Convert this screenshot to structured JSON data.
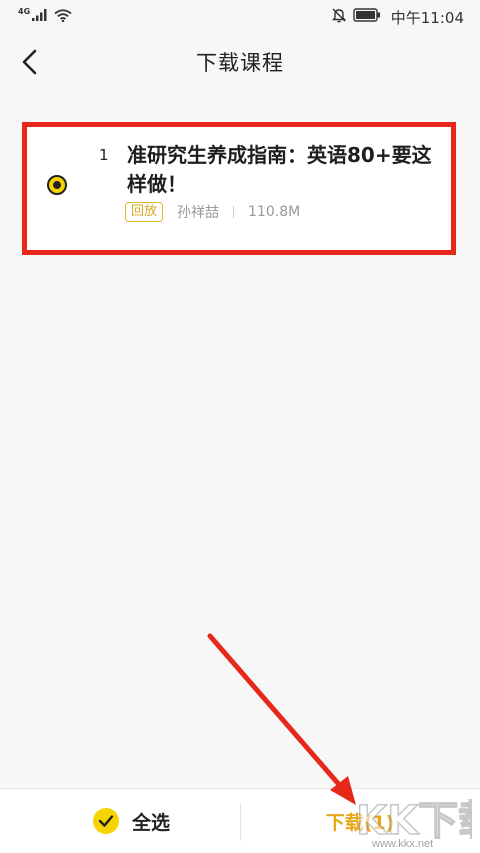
{
  "status_bar": {
    "network": "4G",
    "time": "中午11:04"
  },
  "header": {
    "title": "下载课程"
  },
  "course_list": [
    {
      "index": "1",
      "title": "准研究生养成指南：英语80+要这样做！",
      "badge": "回放",
      "teacher": "孙祥喆",
      "size": "110.8M",
      "selected": true
    }
  ],
  "bottom_bar": {
    "select_all_label": "全选",
    "download_label": "下载(1)"
  },
  "watermark": {
    "url": "www.kkx.net"
  },
  "colors": {
    "accent_yellow": "#f5d400",
    "download_orange": "#e8a617",
    "annotation_red": "#e8271b"
  }
}
